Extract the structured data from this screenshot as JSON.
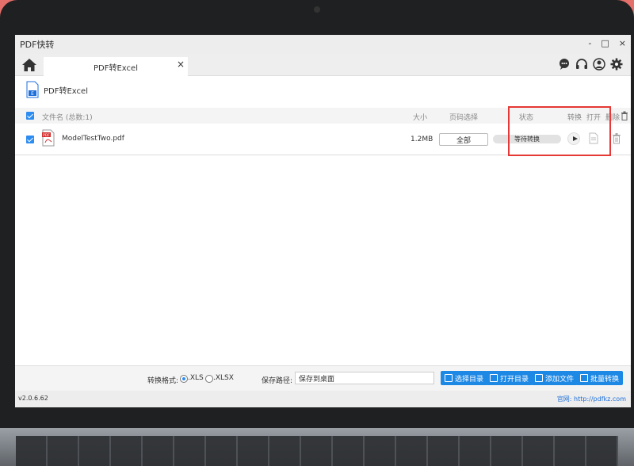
{
  "window": {
    "title": "PDF快转",
    "controls": [
      "-",
      "□",
      "×"
    ]
  },
  "tabs": [
    {
      "label": "PDF转Excel",
      "close": "×"
    }
  ],
  "mode": {
    "label": "PDF转Excel"
  },
  "table": {
    "headers": {
      "filename": "文件名 (总数:1)",
      "size": "大小",
      "pages": "页码选择",
      "status": "状态",
      "convert": "转换",
      "open": "打开",
      "delete": "删除"
    },
    "rows": [
      {
        "name": "ModelTestTwo.pdf",
        "size": "1.2MB",
        "pages": "全部",
        "status": "等待转换",
        "checked": true
      }
    ]
  },
  "bottom": {
    "format_label": "转换格式:",
    "format_options": [
      ".XLS",
      ".XLSX"
    ],
    "format_selected": ".XLS",
    "path_label": "保存路径:",
    "path_value": "保存到桌面",
    "buttons": [
      "选择目录",
      "打开目录",
      "添加文件",
      "批量转换"
    ]
  },
  "statusbar": {
    "version": "v2.0.6.62",
    "site": "官网: http://pdfkz.com"
  },
  "colors": {
    "accent": "#1e88e5",
    "highlight": "#e53935",
    "checkbox": "#2d8cf0"
  },
  "icons": [
    "home-icon",
    "chat-icon",
    "headset-icon",
    "user-icon",
    "gear-icon",
    "excel-file-icon",
    "pdf-file-icon",
    "play-icon",
    "document-icon",
    "trash-icon"
  ]
}
